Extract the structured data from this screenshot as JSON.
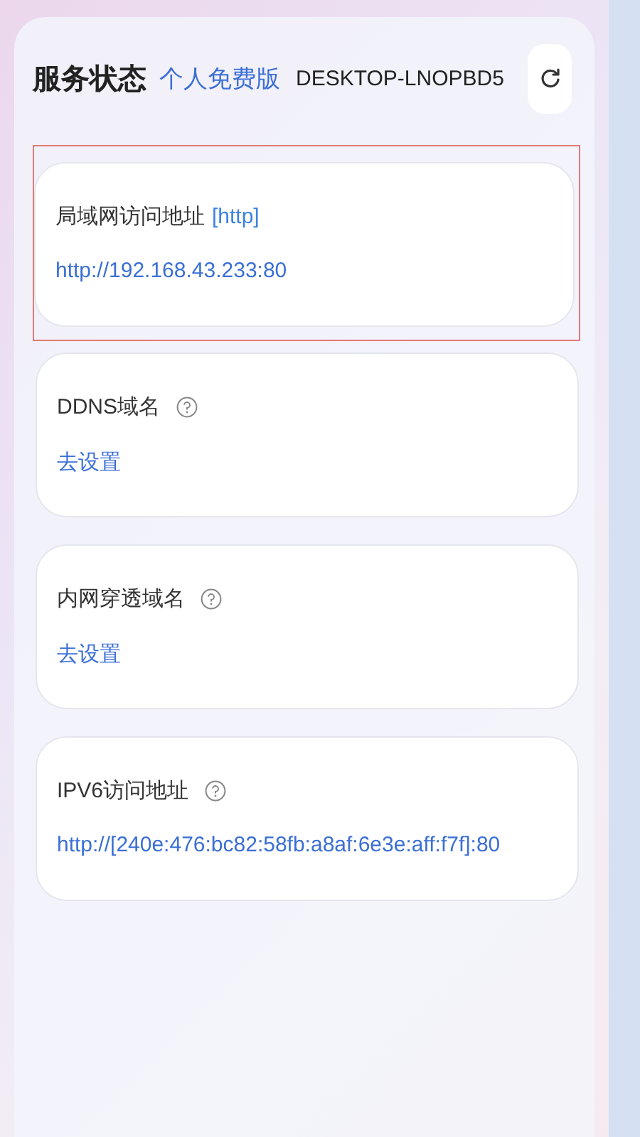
{
  "header": {
    "title": "服务状态",
    "edition": "个人免费版",
    "device": "DESKTOP-LNOPBD5"
  },
  "cards": [
    {
      "label": "局域网访问地址",
      "tag": "[http]",
      "help": false,
      "highlighted": true,
      "value": "http://192.168.43.233:80"
    },
    {
      "label": "DDNS域名",
      "help": true,
      "highlighted": false,
      "value": "去设置"
    },
    {
      "label": "内网穿透域名",
      "help": true,
      "highlighted": false,
      "value": "去设置"
    },
    {
      "label": "IPV6访问地址",
      "help": true,
      "highlighted": false,
      "value": "http://[240e:476:bc82:58fb:a8af:6e3e:aff:f7f]:80"
    }
  ]
}
